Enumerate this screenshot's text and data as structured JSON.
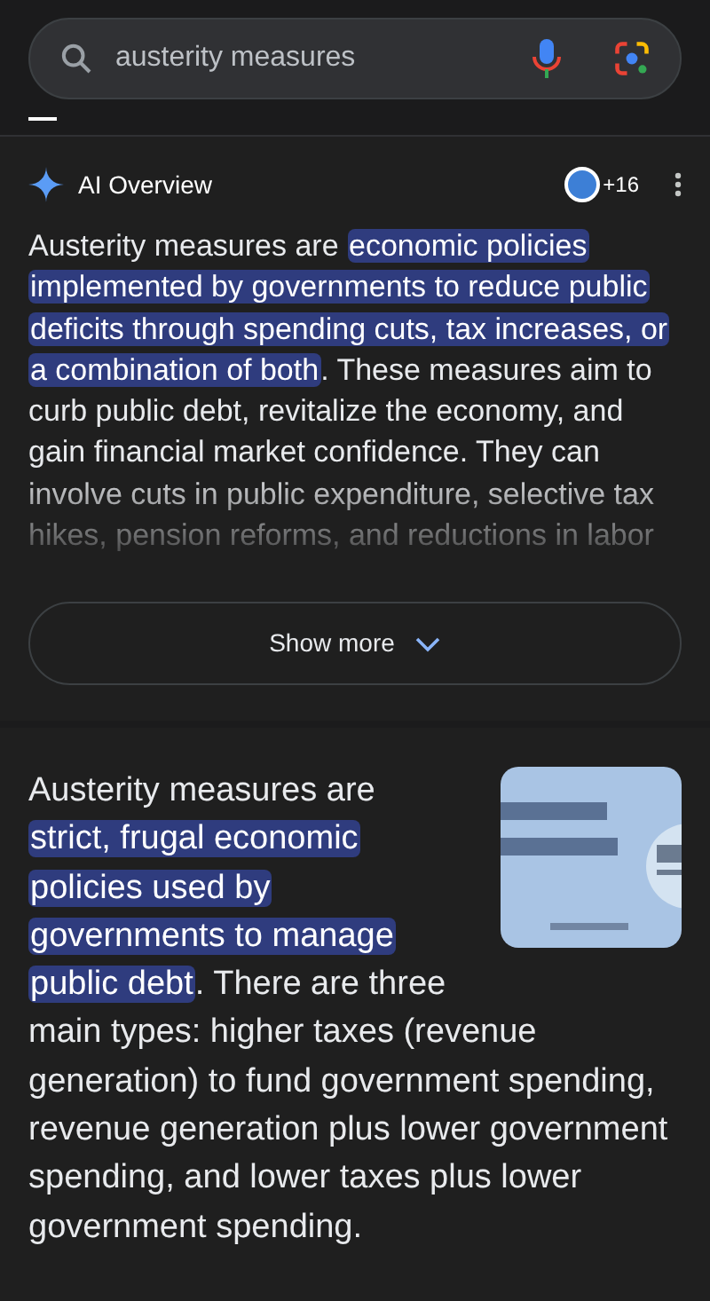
{
  "search": {
    "value": "austerity measures"
  },
  "ai_overview": {
    "title": "AI Overview",
    "source_count": "+16",
    "segments": [
      {
        "text": "Austerity measures are ",
        "highlighted": false
      },
      {
        "text": "economic policies implemented by governments to reduce public deficits through spending cuts, tax increases, or a combination of both",
        "highlighted": true
      },
      {
        "text": ". These measures aim to curb public debt, revitalize the economy, and gain financial market confidence. They can involve cuts in public expenditure, selective tax hikes, pension reforms, and reductions in labor",
        "highlighted": false
      }
    ],
    "show_more": "Show more"
  },
  "snippet": {
    "segments": [
      {
        "text": "Austerity measures are ",
        "highlighted": false
      },
      {
        "text": "strict, frugal economic policies used by governments to manage public debt",
        "highlighted": true
      },
      {
        "text": ". There are three main types: higher taxes (revenue generation) to fund government spending, revenue generation plus lower government spending, and lower taxes plus lower government spending.",
        "highlighted": false
      }
    ]
  }
}
